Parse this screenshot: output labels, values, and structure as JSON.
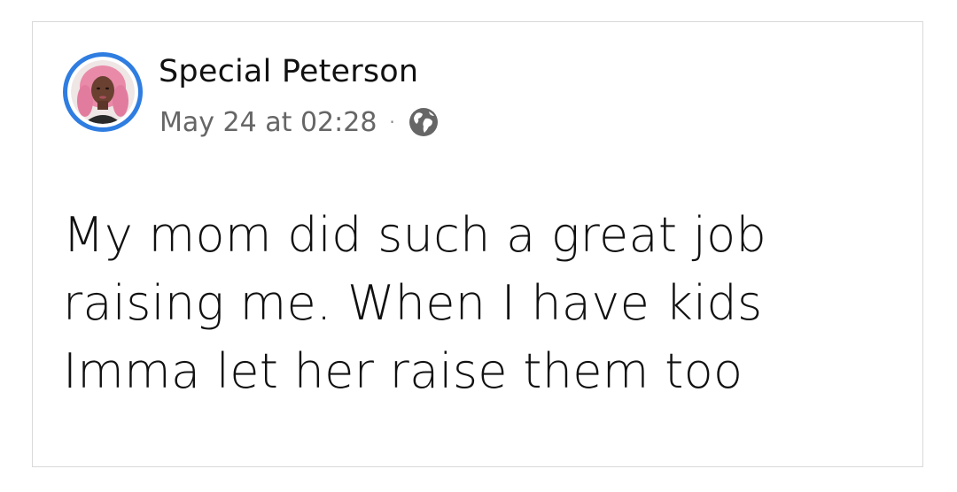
{
  "post": {
    "author": "Special Peterson",
    "timestamp": "May 24 at 02:28",
    "separator": "·",
    "audience_icon": "globe-icon",
    "text": "My mom did such a great job raising me. When I have kids Imma let her raise them too"
  },
  "colors": {
    "avatar_ring": "#2f7de1",
    "meta_text": "#666666",
    "body_text": "#111111",
    "card_border": "#d9d9d9"
  }
}
